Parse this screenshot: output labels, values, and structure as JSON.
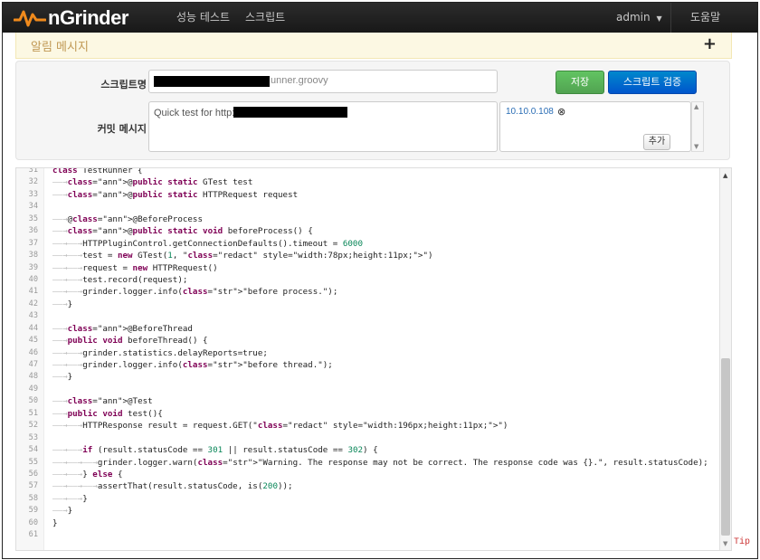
{
  "nav": {
    "brand": "nGrinder",
    "items": [
      "성능 테스트",
      "스크립트"
    ],
    "user": "admin",
    "help": "도움말"
  },
  "notice": {
    "title": "알림 메시지",
    "toggle": "+"
  },
  "form": {
    "script_name_label": "스크립트명",
    "script_name_value": "unner.groovy",
    "commit_label": "커밋 메시지",
    "commit_value": "Quick test for http://",
    "host": "10.10.0.108",
    "add_label": "추가",
    "save_label": "저장",
    "validate_label": "스크립트 검증"
  },
  "tip_label": "Tip",
  "code_lines": [
    {
      "n": "31",
      "t": "class TestRunner {"
    },
    {
      "n": "32",
      "t": "\t@public static GTest test"
    },
    {
      "n": "33",
      "t": "\t@public static HTTPRequest request"
    },
    {
      "n": "34",
      "t": ""
    },
    {
      "n": "35",
      "t": "\t@@BeforeProcess"
    },
    {
      "n": "36",
      "t": "\t@public static void beforeProcess() {"
    },
    {
      "n": "37",
      "t": "\t\tHTTPPluginControl.getConnectionDefaults().timeout = 6000"
    },
    {
      "n": "38",
      "t": "\t\ttest = new GTest(1, \"\")"
    },
    {
      "n": "39",
      "t": "\t\trequest = new HTTPRequest()"
    },
    {
      "n": "40",
      "t": "\t\ttest.record(request);"
    },
    {
      "n": "41",
      "t": "\t\tgrinder.logger.info(\"before process.\");"
    },
    {
      "n": "42",
      "t": "\t}"
    },
    {
      "n": "43",
      "t": ""
    },
    {
      "n": "44",
      "t": "\t@BeforeThread"
    },
    {
      "n": "45",
      "t": "\tpublic void beforeThread() {"
    },
    {
      "n": "46",
      "t": "\t\tgrinder.statistics.delayReports=true;"
    },
    {
      "n": "47",
      "t": "\t\tgrinder.logger.info(\"before thread.\");"
    },
    {
      "n": "48",
      "t": "\t}"
    },
    {
      "n": "49",
      "t": ""
    },
    {
      "n": "50",
      "t": "\t@Test"
    },
    {
      "n": "51",
      "t": "\tpublic void test(){"
    },
    {
      "n": "52",
      "t": "\t\tHTTPResponse result = request.GET(\"\")"
    },
    {
      "n": "53",
      "t": ""
    },
    {
      "n": "54",
      "t": "\t\tif (result.statusCode == 301 || result.statusCode == 302) {"
    },
    {
      "n": "55",
      "t": "\t\t\tgrinder.logger.warn(\"Warning. The response may not be correct. The response code was {}.\", result.statusCode);"
    },
    {
      "n": "56",
      "t": "\t\t} else {"
    },
    {
      "n": "57",
      "t": "\t\t\tassertThat(result.statusCode, is(200));"
    },
    {
      "n": "58",
      "t": "\t\t}"
    },
    {
      "n": "59",
      "t": "\t}"
    },
    {
      "n": "60",
      "t": "}"
    },
    {
      "n": "61",
      "t": ""
    }
  ]
}
